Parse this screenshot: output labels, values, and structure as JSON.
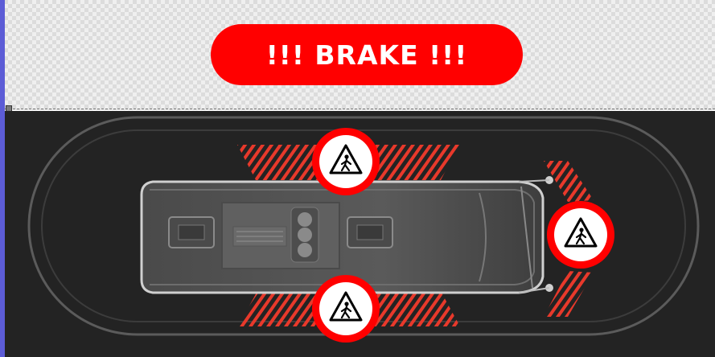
{
  "alert": {
    "text": "!!! BRAKE !!!",
    "color": "#ff0000",
    "text_color": "#ffffff"
  },
  "colors": {
    "background": "#232323",
    "hazard_stripes": "#e8392b",
    "warning_red": "#ff0000"
  },
  "icons": {
    "vehicle": "vehicle-top-view-icon",
    "pedestrian_warning": "pedestrian-warning-icon"
  },
  "pedestrian_alerts": [
    {
      "position": "front-left"
    },
    {
      "position": "front"
    },
    {
      "position": "front-right"
    }
  ]
}
